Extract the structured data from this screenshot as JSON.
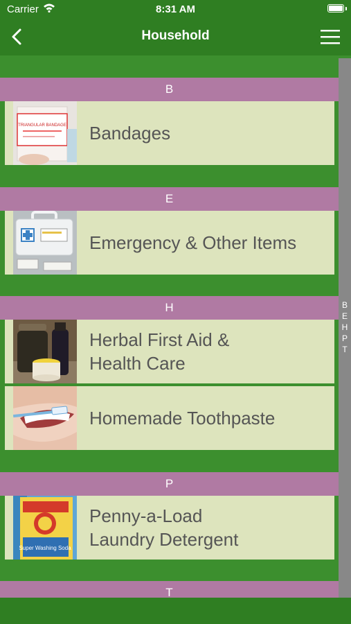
{
  "status_bar": {
    "carrier": "Carrier",
    "time": "8:31 AM"
  },
  "nav": {
    "title": "Household"
  },
  "sections": [
    {
      "letter": "B",
      "items": [
        {
          "label": "Bandages",
          "icon": "triangular-bandage-photo",
          "thumb_text": "TRIANGULAR BANDAGE"
        }
      ]
    },
    {
      "letter": "E",
      "items": [
        {
          "label": "Emergency & Other Items",
          "icon": "first-aid-kit-photo"
        }
      ]
    },
    {
      "letter": "H",
      "items": [
        {
          "label": "Herbal First Aid &\nHealth Care",
          "icon": "herbal-jars-photo"
        },
        {
          "label": "Homemade Toothpaste",
          "icon": "toothbrush-smile-photo"
        }
      ]
    },
    {
      "letter": "P",
      "items": [
        {
          "label": "Penny-a-Load\nLaundry Detergent",
          "icon": "washing-soda-box-photo",
          "thumb_text": "Super Washing Soda"
        }
      ]
    },
    {
      "letter": "T",
      "items": []
    }
  ],
  "index": [
    "B",
    "E",
    "H",
    "P",
    "T"
  ],
  "colors": {
    "nav": "#2f7e22",
    "background": "#3c8f2e",
    "section_header": "#b07aa3",
    "row": "#dde4bd",
    "index_bar": "#888888"
  }
}
